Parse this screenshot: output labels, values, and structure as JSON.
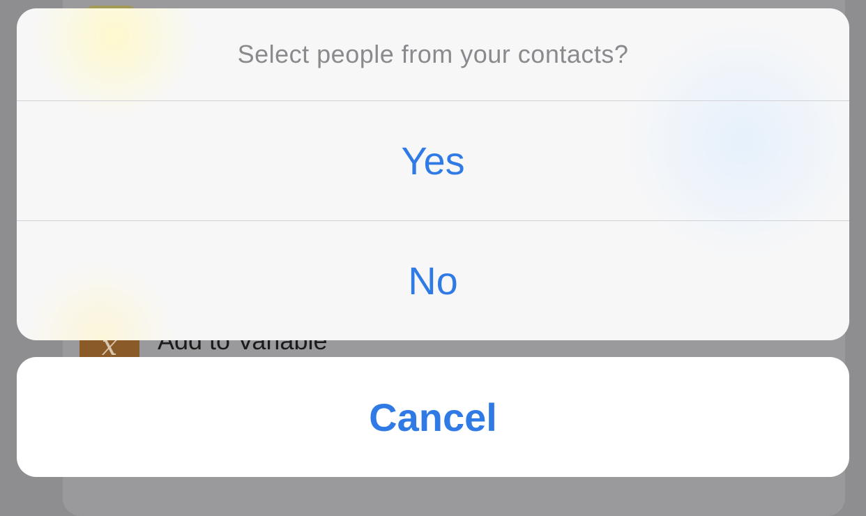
{
  "background": {
    "row_label": "Add to Variable",
    "row_icon_glyph": "x"
  },
  "action_sheet": {
    "title": "Select people from your contacts?",
    "options": [
      {
        "label": "Yes"
      },
      {
        "label": "No"
      }
    ],
    "cancel_label": "Cancel"
  },
  "colors": {
    "accent": "#2f7ae5",
    "title_gray": "#8a8a8e",
    "dim_overlay": "#8e8e90"
  }
}
